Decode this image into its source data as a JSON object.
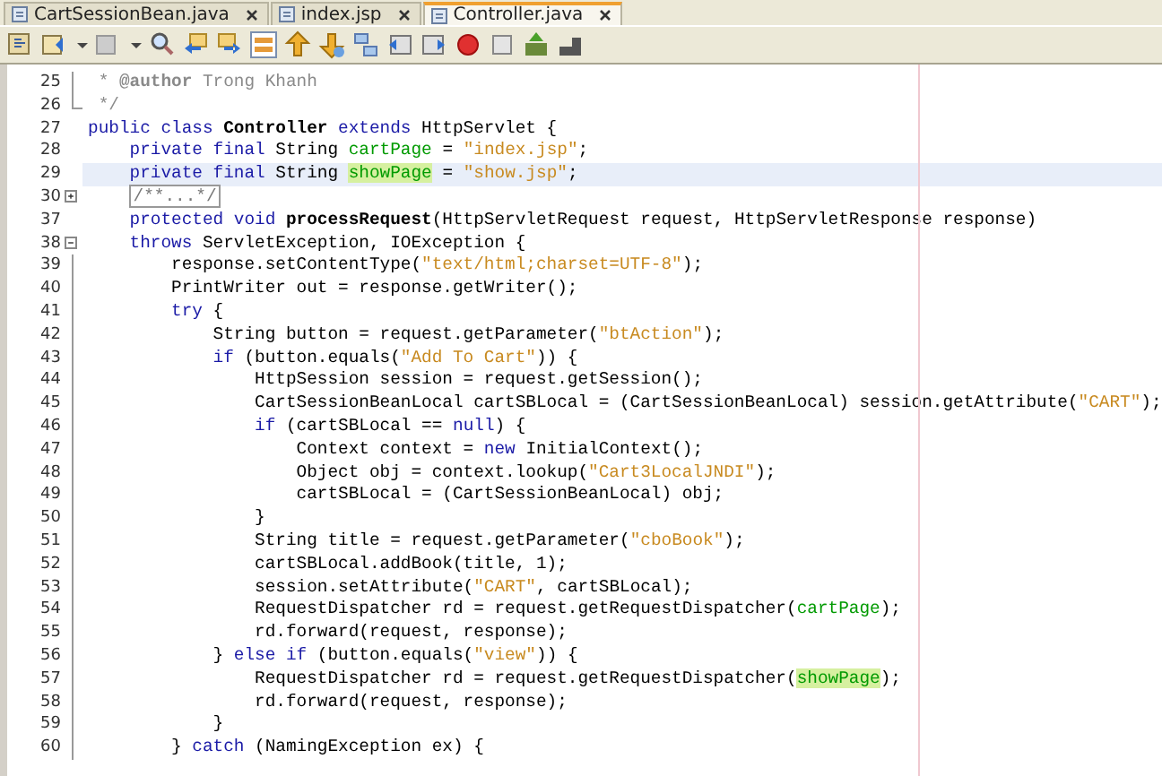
{
  "tabs": [
    {
      "label": "CartSessionBean.java",
      "selected": false
    },
    {
      "label": "index.jsp",
      "selected": false
    },
    {
      "label": "Controller.java",
      "selected": true
    }
  ],
  "editor": {
    "lines": [
      {
        "number": "25",
        "current": false,
        "kind": "code",
        "tokens": [
          {
            "kind": "comment",
            "text": " * "
          },
          {
            "kind": "tag",
            "text": "@author"
          },
          {
            "kind": "comment",
            "text": " Trong Khanh"
          }
        ]
      },
      {
        "number": "26",
        "current": false,
        "kind": "fold_end",
        "tokens": [
          {
            "kind": "comment",
            "text": " */"
          }
        ]
      },
      {
        "number": "27",
        "current": false,
        "kind": "code",
        "tokens": [
          {
            "kind": "keyword",
            "text": "public class "
          },
          {
            "kind": "bold",
            "text": "Controller"
          },
          {
            "kind": "keyword",
            "text": " extends"
          },
          {
            "kind": "plain",
            "text": " HttpServlet {"
          }
        ]
      },
      {
        "number": "28",
        "current": false,
        "kind": "code",
        "tokens": [
          {
            "kind": "keyword",
            "text": "    private final"
          },
          {
            "kind": "plain",
            "text": " String "
          },
          {
            "kind": "field",
            "text": "cartPage",
            "highlighted": false
          },
          {
            "kind": "plain",
            "text": " = "
          },
          {
            "kind": "string",
            "text": "\"index.jsp\""
          },
          {
            "kind": "plain",
            "text": ";"
          }
        ]
      },
      {
        "number": "29",
        "current": true,
        "kind": "code",
        "tokens": [
          {
            "kind": "keyword",
            "text": "    private final"
          },
          {
            "kind": "plain",
            "text": " String "
          },
          {
            "kind": "field",
            "text": "showPage",
            "highlighted": true
          },
          {
            "kind": "plain",
            "text": " = "
          },
          {
            "kind": "string",
            "text": "\"show.jsp\""
          },
          {
            "kind": "plain",
            "text": ";"
          }
        ]
      },
      {
        "number": "30",
        "current": false,
        "kind": "fold_collapsed",
        "tokens": [
          {
            "kind": "folded",
            "text": "/**...*/"
          }
        ]
      },
      {
        "number": "37",
        "current": false,
        "kind": "code",
        "tokens": [
          {
            "kind": "keyword",
            "text": "    protected void "
          },
          {
            "kind": "bold",
            "text": "processRequest"
          },
          {
            "kind": "plain",
            "text": "(HttpServletRequest request, HttpServletResponse response)"
          }
        ]
      },
      {
        "number": "38",
        "current": false,
        "kind": "fold_expanded",
        "tokens": [
          {
            "kind": "keyword",
            "text": "    throws"
          },
          {
            "kind": "plain",
            "text": " ServletException, IOException {"
          }
        ]
      },
      {
        "number": "39",
        "current": false,
        "kind": "code",
        "tokens": [
          {
            "kind": "plain",
            "text": "        response.setContentType("
          },
          {
            "kind": "string",
            "text": "\"text/html;charset=UTF-8\""
          },
          {
            "kind": "plain",
            "text": ");"
          }
        ]
      },
      {
        "number": "40",
        "current": false,
        "kind": "code",
        "tokens": [
          {
            "kind": "plain",
            "text": "        PrintWriter out = response.getWriter();"
          }
        ]
      },
      {
        "number": "41",
        "current": false,
        "kind": "code",
        "tokens": [
          {
            "kind": "keyword",
            "text": "        try"
          },
          {
            "kind": "plain",
            "text": " {"
          }
        ]
      },
      {
        "number": "42",
        "current": false,
        "kind": "code",
        "tokens": [
          {
            "kind": "plain",
            "text": "            String button = request.getParameter("
          },
          {
            "kind": "string",
            "text": "\"btAction\""
          },
          {
            "kind": "plain",
            "text": ");"
          }
        ]
      },
      {
        "number": "43",
        "current": false,
        "kind": "code",
        "tokens": [
          {
            "kind": "keyword",
            "text": "            if"
          },
          {
            "kind": "plain",
            "text": " (button.equals("
          },
          {
            "kind": "string",
            "text": "\"Add To Cart\""
          },
          {
            "kind": "plain",
            "text": ")) {"
          }
        ]
      },
      {
        "number": "44",
        "current": false,
        "kind": "code",
        "tokens": [
          {
            "kind": "plain",
            "text": "                HttpSession session = request.getSession();"
          }
        ]
      },
      {
        "number": "45",
        "current": false,
        "kind": "code",
        "tokens": [
          {
            "kind": "plain",
            "text": "                CartSessionBeanLocal cartSBLocal = (CartSessionBeanLocal) session.getAttribute("
          },
          {
            "kind": "string",
            "text": "\"CART\""
          },
          {
            "kind": "plain",
            "text": ");"
          }
        ]
      },
      {
        "number": "46",
        "current": false,
        "kind": "code",
        "tokens": [
          {
            "kind": "keyword",
            "text": "                if"
          },
          {
            "kind": "plain",
            "text": " (cartSBLocal == "
          },
          {
            "kind": "keyword",
            "text": "null"
          },
          {
            "kind": "plain",
            "text": ") {"
          }
        ]
      },
      {
        "number": "47",
        "current": false,
        "kind": "code",
        "tokens": [
          {
            "kind": "plain",
            "text": "                    Context context = "
          },
          {
            "kind": "keyword",
            "text": "new"
          },
          {
            "kind": "plain",
            "text": " InitialContext();"
          }
        ]
      },
      {
        "number": "48",
        "current": false,
        "kind": "code",
        "tokens": [
          {
            "kind": "plain",
            "text": "                    Object obj = context.lookup("
          },
          {
            "kind": "string",
            "text": "\"Cart3LocalJNDI\""
          },
          {
            "kind": "plain",
            "text": ");"
          }
        ]
      },
      {
        "number": "49",
        "current": false,
        "kind": "code",
        "tokens": [
          {
            "kind": "plain",
            "text": "                    cartSBLocal = (CartSessionBeanLocal) obj;"
          }
        ]
      },
      {
        "number": "50",
        "current": false,
        "kind": "code",
        "tokens": [
          {
            "kind": "plain",
            "text": "                }"
          }
        ]
      },
      {
        "number": "51",
        "current": false,
        "kind": "code",
        "tokens": [
          {
            "kind": "plain",
            "text": "                String title = request.getParameter("
          },
          {
            "kind": "string",
            "text": "\"cboBook\""
          },
          {
            "kind": "plain",
            "text": ");"
          }
        ]
      },
      {
        "number": "52",
        "current": false,
        "kind": "code",
        "tokens": [
          {
            "kind": "plain",
            "text": "                cartSBLocal.addBook(title, 1);"
          }
        ]
      },
      {
        "number": "53",
        "current": false,
        "kind": "code",
        "tokens": [
          {
            "kind": "plain",
            "text": "                session.setAttribute("
          },
          {
            "kind": "string",
            "text": "\"CART\""
          },
          {
            "kind": "plain",
            "text": ", cartSBLocal);"
          }
        ]
      },
      {
        "number": "54",
        "current": false,
        "kind": "code",
        "tokens": [
          {
            "kind": "plain",
            "text": "                RequestDispatcher rd = request.getRequestDispatcher("
          },
          {
            "kind": "field",
            "text": "cartPage",
            "highlighted": false
          },
          {
            "kind": "plain",
            "text": ");"
          }
        ]
      },
      {
        "number": "55",
        "current": false,
        "kind": "code",
        "tokens": [
          {
            "kind": "plain",
            "text": "                rd.forward(request, response);"
          }
        ]
      },
      {
        "number": "56",
        "current": false,
        "kind": "code",
        "tokens": [
          {
            "kind": "plain",
            "text": "            } "
          },
          {
            "kind": "keyword",
            "text": "else if"
          },
          {
            "kind": "plain",
            "text": " (button.equals("
          },
          {
            "kind": "string",
            "text": "\"view\""
          },
          {
            "kind": "plain",
            "text": ")) {"
          }
        ]
      },
      {
        "number": "57",
        "current": false,
        "kind": "code",
        "tokens": [
          {
            "kind": "plain",
            "text": "                RequestDispatcher rd = request.getRequestDispatcher("
          },
          {
            "kind": "field",
            "text": "showPage",
            "highlighted": true
          },
          {
            "kind": "plain",
            "text": ");"
          }
        ]
      },
      {
        "number": "58",
        "current": false,
        "kind": "code",
        "tokens": [
          {
            "kind": "plain",
            "text": "                rd.forward(request, response);"
          }
        ]
      },
      {
        "number": "59",
        "current": false,
        "kind": "code",
        "tokens": [
          {
            "kind": "plain",
            "text": "            }"
          }
        ]
      },
      {
        "number": "60",
        "current": false,
        "kind": "code",
        "tokens": [
          {
            "kind": "plain",
            "text": "        } "
          },
          {
            "kind": "keyword",
            "text": "catch"
          },
          {
            "kind": "plain",
            "text": " (NamingException ex) {"
          }
        ]
      }
    ]
  }
}
